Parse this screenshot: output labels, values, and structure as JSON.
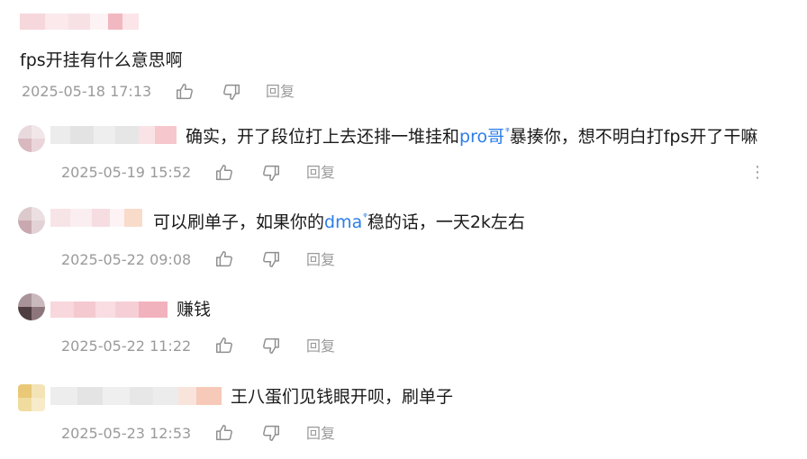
{
  "main_comment": {
    "text": "fps开挂有什么意思啊",
    "time": "2025-05-18 17:13",
    "reply_label": "回复"
  },
  "replies": [
    {
      "text_before": "确实，开了段位打上去还排一堆挂和",
      "link": "pro哥",
      "text_after": "暴揍你，想不明白打fps开了干嘛",
      "time": "2025-05-19 15:52",
      "reply_label": "回复",
      "more_label": "⋮"
    },
    {
      "text_before": "可以刷单子，如果你的",
      "link": "dma",
      "text_after": "稳的话，一天2k左右",
      "time": "2025-05-22 09:08",
      "reply_label": "回复"
    },
    {
      "text": "赚钱",
      "time": "2025-05-22 11:22",
      "reply_label": "回复"
    },
    {
      "text": "王八蛋们见钱眼开呗，刷单子",
      "time": "2025-05-23 12:53",
      "reply_label": "回复"
    }
  ],
  "icons": {
    "like": "thumbs-up-icon",
    "dislike": "thumbs-down-icon",
    "search_superscript": "search-icon",
    "search_glyph": "ᵠ"
  },
  "colors": {
    "link": "#2b7de9",
    "meta": "#9a9a9a",
    "text": "#1a1a1a"
  }
}
